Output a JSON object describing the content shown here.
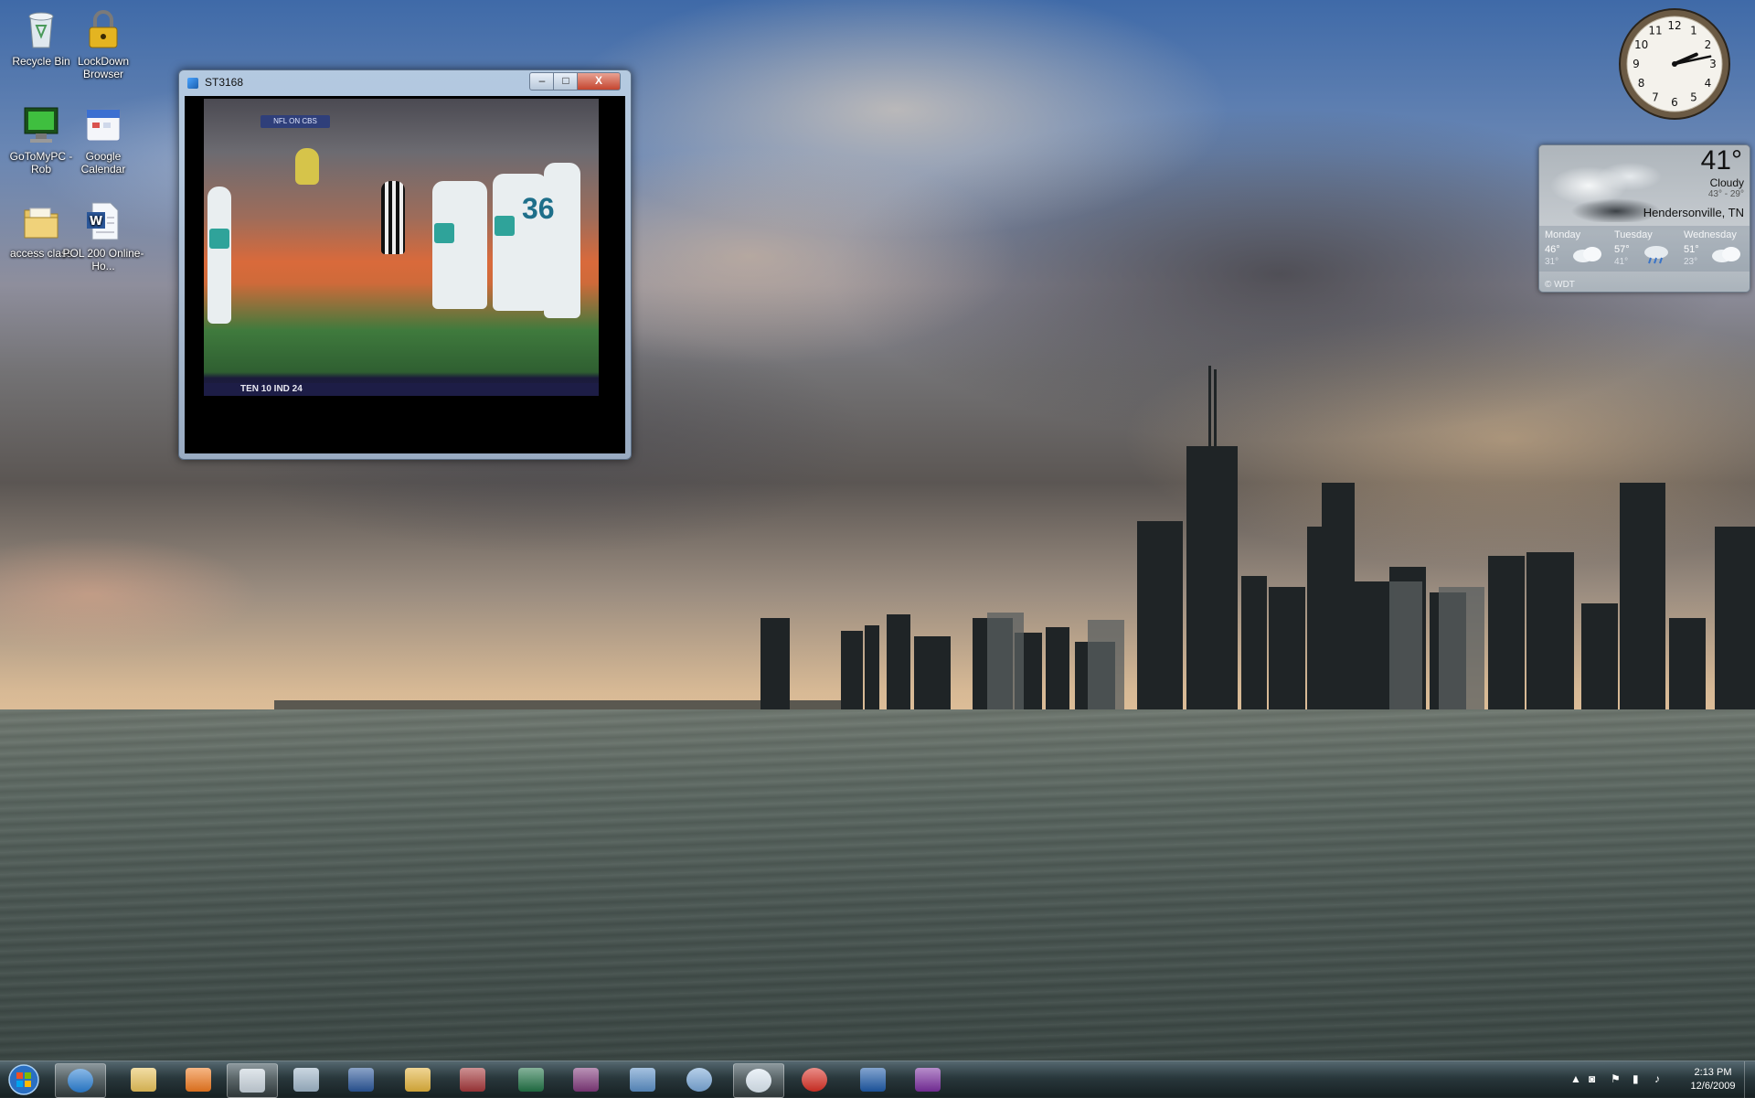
{
  "desktop": {
    "icons": [
      {
        "label": "Recycle Bin",
        "icon": "recycle-bin-icon"
      },
      {
        "label": "LockDown Browser",
        "icon": "lock-icon"
      },
      {
        "label": "GoToMyPC - Rob",
        "icon": "remote-pc-icon"
      },
      {
        "label": "Google Calendar",
        "icon": "calendar-icon"
      },
      {
        "label": "access class",
        "icon": "folder-icon"
      },
      {
        "label": "POL 200 Online-Ho...",
        "icon": "word-document-icon"
      }
    ]
  },
  "window": {
    "title": "ST3168",
    "minimize": "–",
    "maximize": "□",
    "close": "X",
    "video": {
      "network_logo": "NFL ON CBS",
      "jersey_number": "36",
      "score_text": "TEN   10   IND   24"
    }
  },
  "clock": {
    "hour": 2,
    "minute": 13,
    "numerals": [
      "12",
      "1",
      "2",
      "3",
      "4",
      "5",
      "6",
      "7",
      "8",
      "9",
      "10",
      "11"
    ]
  },
  "weather": {
    "temperature": "41°",
    "condition": "Cloudy",
    "range": "43° - 29°",
    "city": "Hendersonville, TN",
    "days": [
      {
        "name": "Monday",
        "high": "46°",
        "low": "31°"
      },
      {
        "name": "Tuesday",
        "high": "57°",
        "low": "41°"
      },
      {
        "name": "Wednesday",
        "high": "51°",
        "low": "23°"
      }
    ],
    "credit": "© WDT"
  },
  "taskbar": {
    "start": "windows-start-icon",
    "items": [
      {
        "icon": "internet-explorer-icon",
        "color": "#2a7fd4"
      },
      {
        "icon": "file-explorer-icon",
        "color": "#e8c25a"
      },
      {
        "icon": "media-player-icon",
        "color": "#f07a20"
      },
      {
        "icon": "snipping-tool-icon",
        "color": "#c8d3dc"
      },
      {
        "icon": "calculator-icon",
        "color": "#9fb6c9"
      },
      {
        "icon": "word-icon",
        "color": "#2b579a"
      },
      {
        "icon": "outlook-icon",
        "color": "#e3b33c"
      },
      {
        "icon": "access-icon",
        "color": "#a4373a"
      },
      {
        "icon": "excel-icon",
        "color": "#217346"
      },
      {
        "icon": "onenote-icon",
        "color": "#80397b"
      },
      {
        "icon": "picture-viewer-icon",
        "color": "#5b8fc6"
      },
      {
        "icon": "itunes-icon",
        "color": "#7aa8d8"
      },
      {
        "icon": "media-app-icon",
        "color": "#dce8f2"
      },
      {
        "icon": "chrome-icon",
        "color": "#d93025"
      },
      {
        "icon": "virtualbox-icon",
        "color": "#1e5aa8"
      },
      {
        "icon": "yahoo-messenger-icon",
        "color": "#7b2fa0"
      }
    ],
    "tray": {
      "time": "2:13 PM",
      "date": "12/6/2009"
    }
  }
}
